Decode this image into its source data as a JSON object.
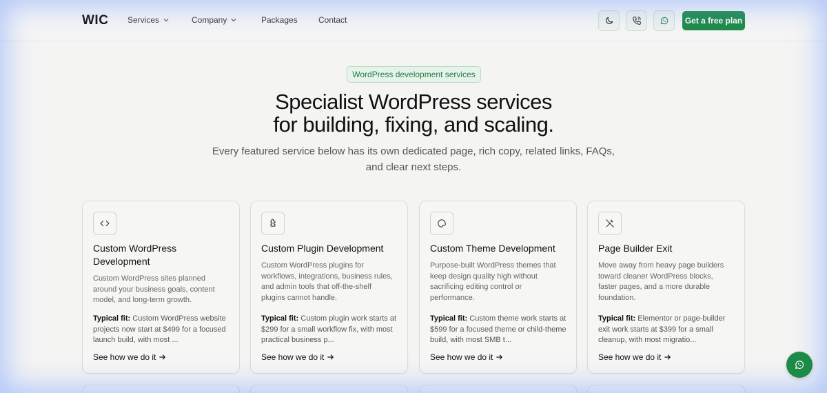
{
  "brand": {
    "logo": "WIC",
    "accent": "#1e8a47"
  },
  "nav": [
    {
      "label": "Services",
      "has_dropdown": true
    },
    {
      "label": "Company",
      "has_dropdown": true
    },
    {
      "label": "Packages",
      "has_dropdown": false
    },
    {
      "label": "Contact",
      "has_dropdown": false
    }
  ],
  "header_actions": {
    "theme_icon": "moon-icon",
    "phone_icon": "phone-icon",
    "whatsapp_icon": "whatsapp-icon",
    "cta_label": "Get a free plan"
  },
  "hero": {
    "badge": "WordPress development services",
    "title_line1": "Specialist WordPress services",
    "title_line2": "for building, fixing, and scaling.",
    "subtitle": "Every featured service below has its own dedicated page, rich copy, related links, FAQs, and clear next steps."
  },
  "cards": [
    {
      "icon": "code-icon",
      "title": "Custom WordPress Development",
      "desc": "Custom WordPress sites planned around your business goals, content model, and long-term growth.",
      "fit_label": "Typical fit:",
      "fit_text": "Custom WordPress website projects now start at $499 for a focused launch build, with most ...",
      "link": "See how we do it"
    },
    {
      "icon": "puzzle-icon",
      "title": "Custom Plugin Development",
      "desc": "Custom WordPress plugins for workflows, integrations, business rules, and admin tools that off-the-shelf plugins cannot handle.",
      "fit_label": "Typical fit:",
      "fit_text": "Custom plugin work starts at $299 for a small workflow fix, with most practical business p...",
      "link": "See how we do it"
    },
    {
      "icon": "palette-icon",
      "title": "Custom Theme Development",
      "desc": "Purpose-built WordPress themes that keep design quality high without sacrificing editing control or performance.",
      "fit_label": "Typical fit:",
      "fit_text": "Custom theme work starts at $599 for a focused theme or child-theme build, with most SMB t...",
      "link": "See how we do it"
    },
    {
      "icon": "wand-off-icon",
      "title": "Page Builder Exit",
      "desc": "Move away from heavy page builders toward cleaner WordPress blocks, faster pages, and a more durable foundation.",
      "fit_label": "Typical fit:",
      "fit_text": "Elementor or page-builder exit work starts at $399 for a small cleanup, with most migratio...",
      "link": "See how we do it"
    }
  ],
  "floating": {
    "icon": "whatsapp-icon"
  }
}
